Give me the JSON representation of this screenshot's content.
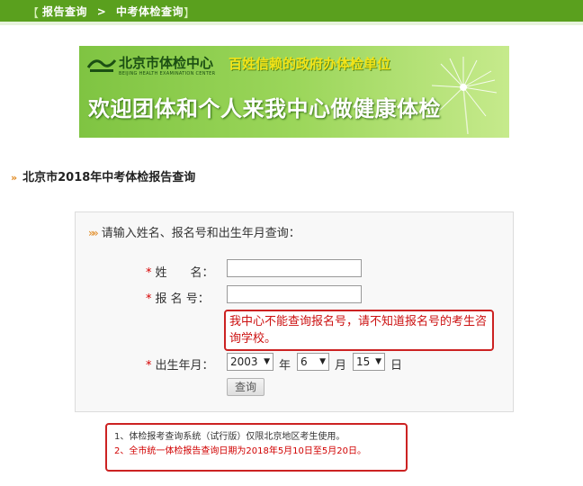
{
  "breadcrumb": {
    "home": "报告查询",
    "separator": ">",
    "current": "中考体检查询"
  },
  "banner": {
    "org_name": "北京市体检中心",
    "org_sub": "BEIJING HEALTH EXAMINATION CENTER",
    "slogan": "百姓信赖的政府办体检单位",
    "tagline": "欢迎团体和个人来我中心做健康体检"
  },
  "section_title": "北京市2018年中考体检报告查询",
  "form": {
    "prompt": "请输入姓名、报名号和出生年月查询：",
    "required_mark": "*",
    "name_label": "姓　　名：",
    "name_value": "",
    "regno_label": "报 名 号：",
    "regno_value": "",
    "hint": "我中心不能查询报名号，请不知道报名号的考生咨询学校。",
    "birth_label": "出生年月：",
    "year_value": "2003",
    "year_unit": "年",
    "month_value": "6",
    "month_unit": "月",
    "day_value": "15",
    "day_unit": "日",
    "submit_label": "查询"
  },
  "notes": {
    "line1": "1、体检报考查询系统（试行版）仅限北京地区考生使用。",
    "line2_prefix": "2、",
    "line2_highlight": "全市统一",
    "line2_rest": "体检报告查询日期为2018年5月10日至5月20日。"
  },
  "colors": {
    "topbar": "#5aa01e",
    "alert": "#cc2222",
    "accent": "#e0861a"
  }
}
